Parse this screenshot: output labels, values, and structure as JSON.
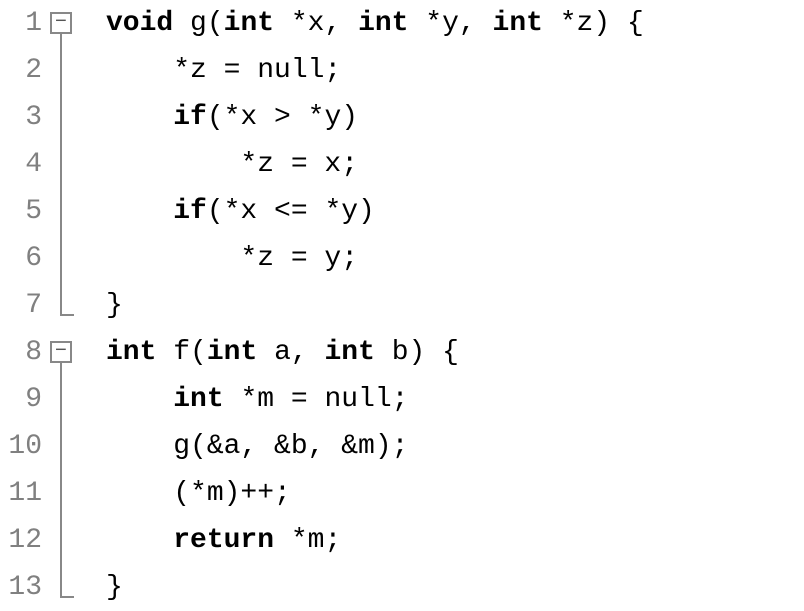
{
  "lines": [
    {
      "num": "1"
    },
    {
      "num": "2"
    },
    {
      "num": "3"
    },
    {
      "num": "4"
    },
    {
      "num": "5"
    },
    {
      "num": "6"
    },
    {
      "num": "7"
    },
    {
      "num": "8"
    },
    {
      "num": "9"
    },
    {
      "num": "10"
    },
    {
      "num": "11"
    },
    {
      "num": "12"
    },
    {
      "num": "13"
    }
  ],
  "code": {
    "l1": {
      "kw1": "void",
      "t1": " g(",
      "kw2": "int",
      "t2": " *x, ",
      "kw3": "int",
      "t3": " *y, ",
      "kw4": "int",
      "t4": " *z) {"
    },
    "l2": {
      "t1": "    *z = null;"
    },
    "l3": {
      "t1": "    ",
      "kw1": "if",
      "t2": "(*x > *y)"
    },
    "l4": {
      "t1": "        *z = x;"
    },
    "l5": {
      "t1": "    ",
      "kw1": "if",
      "t2": "(*x <= *y)"
    },
    "l6": {
      "t1": "        *z = y;"
    },
    "l7": {
      "t1": "}"
    },
    "l8": {
      "kw1": "int",
      "t1": " f(",
      "kw2": "int",
      "t2": " a, ",
      "kw3": "int",
      "t3": " b) {"
    },
    "l9": {
      "t1": "    ",
      "kw1": "int",
      "t2": " *m = null;"
    },
    "l10": {
      "t1": "    g(&a, &b, &m);"
    },
    "l11": {
      "t1": "    (*m)++;"
    },
    "l12": {
      "t1": "    ",
      "kw1": "return",
      "t2": " *m;"
    },
    "l13": {
      "t1": "}"
    }
  },
  "fold": {
    "minus": "−"
  }
}
